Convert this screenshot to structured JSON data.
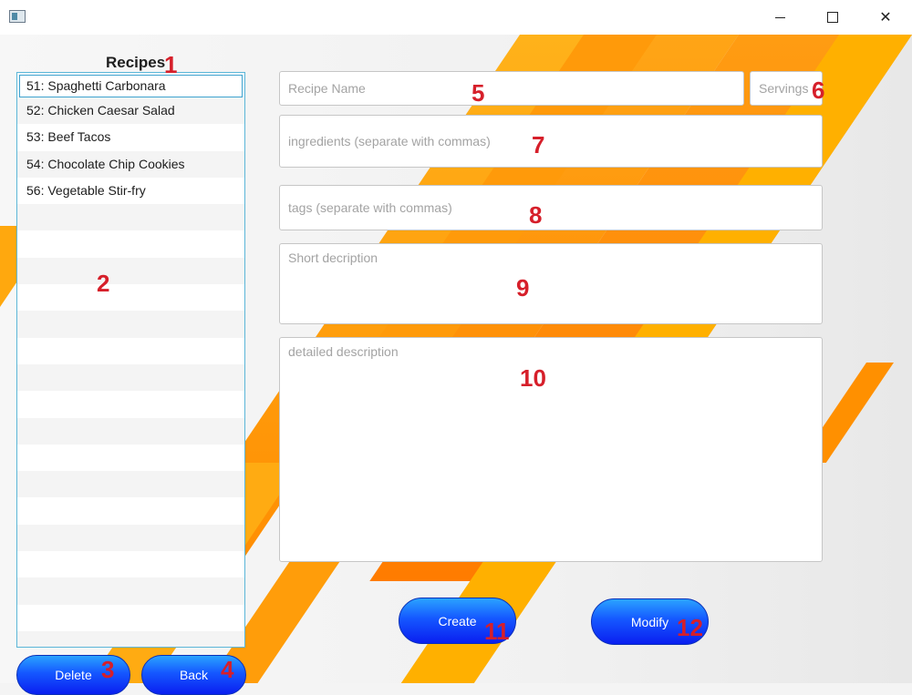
{
  "window": {
    "minimize_glyph": "",
    "close_glyph": "✕"
  },
  "recipes": {
    "title": "Recipes",
    "items": [
      {
        "label": "51: Spaghetti Carbonara"
      },
      {
        "label": "52: Chicken Caesar Salad"
      },
      {
        "label": "53: Beef Tacos"
      },
      {
        "label": "54: Chocolate Chip Cookies"
      },
      {
        "label": "56: Vegetable Stir-fry"
      }
    ],
    "selected_index": 0
  },
  "form": {
    "recipe_name": {
      "placeholder": "Recipe Name",
      "value": ""
    },
    "servings": {
      "placeholder": "Servings",
      "value": ""
    },
    "ingredients": {
      "placeholder": "ingredients (separate with commas)",
      "value": ""
    },
    "tags": {
      "placeholder": "tags (separate with commas)",
      "value": ""
    },
    "short_description": {
      "placeholder": "Short decription",
      "value": ""
    },
    "detailed_description": {
      "placeholder": "detailed description",
      "value": ""
    }
  },
  "buttons": {
    "delete": "Delete",
    "back": "Back",
    "create": "Create",
    "modify": "Modify"
  },
  "markers": [
    "1",
    "2",
    "3",
    "4",
    "5",
    "6",
    "7",
    "8",
    "9",
    "10",
    "11",
    "12"
  ],
  "colors": {
    "accent_orange": "#ff9a0a",
    "button_blue": "#1557ff",
    "marker_red": "#d61f2a",
    "list_border": "#5bb6d8"
  }
}
